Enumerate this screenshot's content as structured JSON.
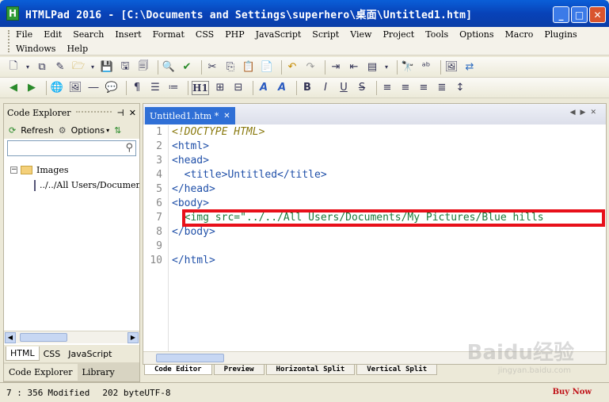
{
  "window": {
    "app_icon": "H",
    "title": "HTMLPad 2016 - [C:\\Documents and Settings\\superhero\\桌面\\Untitled1.htm]",
    "buttons": [
      "minimize-icon",
      "maximize-icon",
      "close-icon"
    ]
  },
  "menu": {
    "row1": [
      "File",
      "Edit",
      "Search",
      "Insert",
      "Format",
      "CSS",
      "PHP",
      "JavaScript",
      "Script",
      "View",
      "Project",
      "Tools",
      "Options",
      "Macro",
      "Plugins"
    ],
    "row2": [
      "Windows",
      "Help"
    ]
  },
  "toolbar": {
    "heading_label": "H1"
  },
  "left_panel": {
    "title": "Code Explorer",
    "pin_label": "📌",
    "close_label": "✕",
    "refresh_label": "Refresh",
    "options_label": "Options",
    "search_placeholder": "",
    "tree": {
      "folder_label": "Images",
      "file_label": "../../All Users/Documents/My Pictures/Blue hills"
    },
    "bottom_tabs": [
      "HTML",
      "CSS",
      "JavaScript"
    ],
    "panel_tabs": [
      "Code Explorer",
      "Library"
    ]
  },
  "editor": {
    "tab_title": "Untitled1.htm *",
    "lines": [
      {
        "num": "1",
        "text": "<!DOCTYPE HTML>"
      },
      {
        "num": "2",
        "text": "<html>"
      },
      {
        "num": "3",
        "text": "<head>"
      },
      {
        "num": "4",
        "text": "  <title>Untitled</title>"
      },
      {
        "num": "5",
        "text": "</head>"
      },
      {
        "num": "6",
        "text": "<body>"
      },
      {
        "num": "7",
        "text": "  <img src=\"../../All Users/Documents/My Pictures/Blue hills"
      },
      {
        "num": "8",
        "text": "</body>"
      },
      {
        "num": "9",
        "text": ""
      },
      {
        "num": "10",
        "text": "</html>"
      }
    ],
    "highlight_color": "#e8101a"
  },
  "view_tabs": [
    "Code Editor",
    "Preview",
    "Horizontal Split",
    "Vertical Split"
  ],
  "status": {
    "position": "7 : 356",
    "state": "Modified",
    "size": "202 byte",
    "encoding": "UTF-8",
    "buy_now": "Buy Now"
  },
  "watermark": {
    "main": "Baidu经验",
    "sub": "jingyan.baidu.com"
  }
}
